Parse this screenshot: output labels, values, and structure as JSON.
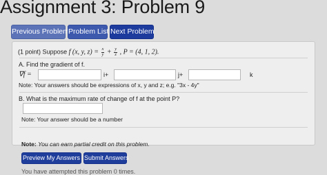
{
  "header": {
    "title": "Assignment 3: Problem 9"
  },
  "nav": {
    "prev_label": "Previous Problem",
    "list_label": "Problem List",
    "next_label": "Next Problem"
  },
  "problem": {
    "points": "(1 point)",
    "suppose_word": "Suppose",
    "function_lhs": "f (x, y, z) =",
    "frac1_num": "x",
    "frac1_den": "y",
    "plus": "+",
    "frac2_num": "y",
    "frac2_den": "z",
    "point_expr": ", P = (4, 1, 2).",
    "partA": {
      "prompt": "A. Find the gradient of f.",
      "grad_label": "∇f =",
      "i_label": "i+",
      "j_label": "j+",
      "k_label": "k",
      "note": "Note: Your answers should be expressions of x, y and z; e.g. \"3x - 4y\""
    },
    "partB": {
      "prompt": "B. What is the maximum rate of change of f at the point P?",
      "note": "Note: Your answer should be a number"
    }
  },
  "footer": {
    "note_label": "Note:",
    "note_text": "You can earn partial credit on this problem.",
    "preview_label": "Preview My Answers",
    "submit_label": "Submit Answers",
    "attempted_text": "You have attempted this problem 0 times."
  }
}
